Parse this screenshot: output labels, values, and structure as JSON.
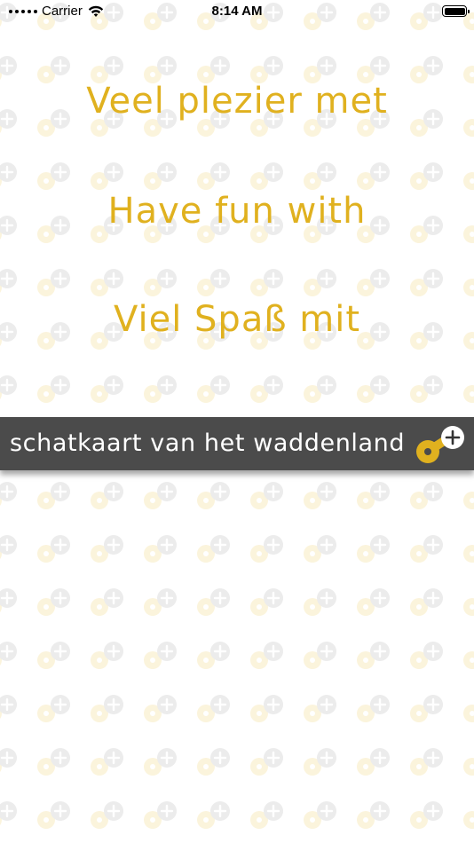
{
  "status_bar": {
    "carrier": "Carrier",
    "time": "8:14 AM"
  },
  "greetings": [
    "Veel plezier met",
    "Have fun with",
    "Viel Spaß mit"
  ],
  "brand": {
    "name": "schatkaart van het waddenland"
  },
  "colors": {
    "accent": "#e0b11f",
    "bar_background": "#4b4b4b",
    "bar_text": "#ffffff",
    "logo_plus_circle": "#ffffff"
  },
  "icons": {
    "wifi": "wifi-icon",
    "battery": "battery-icon",
    "logo": "app-logo-icon",
    "background": "logo-pattern"
  }
}
